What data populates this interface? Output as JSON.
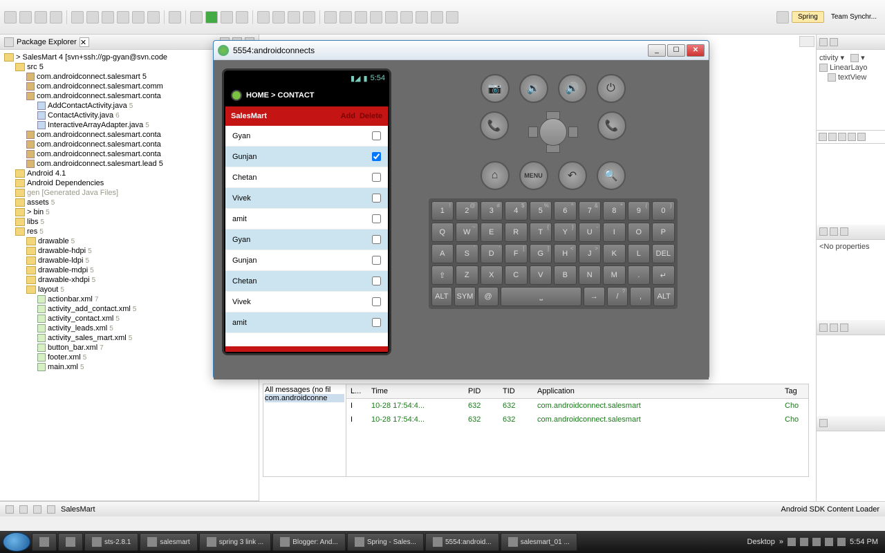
{
  "toolbar": {
    "perspectives": [
      "Spring",
      "Team Synchr..."
    ]
  },
  "packageExplorer": {
    "title": "Package Explorer",
    "root": "> SalesMart 4 [svn+ssh://gp-gyan@svn.code",
    "src": "src 5",
    "packages": [
      "com.androidconnect.salesmart 5",
      "com.androidconnect.salesmart.comm",
      "com.androidconnect.salesmart.conta"
    ],
    "javaFiles": [
      {
        "name": "AddContactActivity.java",
        "rev": "5"
      },
      {
        "name": "ContactActivity.java",
        "rev": "6"
      },
      {
        "name": "InteractiveArrayAdapter.java",
        "rev": "5"
      }
    ],
    "packages2": [
      "com.androidconnect.salesmart.conta",
      "com.androidconnect.salesmart.conta",
      "com.androidconnect.salesmart.conta",
      "com.androidconnect.salesmart.lead 5"
    ],
    "libs": [
      "Android 4.1",
      "Android Dependencies"
    ],
    "gen": "gen [Generated Java Files]",
    "folders": [
      {
        "name": "assets",
        "rev": "5"
      },
      {
        "name": "> bin",
        "rev": "5"
      },
      {
        "name": "libs",
        "rev": "5"
      },
      {
        "name": "res",
        "rev": "5"
      }
    ],
    "drawables": [
      {
        "name": "drawable",
        "rev": "5"
      },
      {
        "name": "drawable-hdpi",
        "rev": "5"
      },
      {
        "name": "drawable-ldpi",
        "rev": "5"
      },
      {
        "name": "drawable-mdpi",
        "rev": "5"
      },
      {
        "name": "drawable-xhdpi",
        "rev": "5"
      },
      {
        "name": "layout",
        "rev": "5"
      }
    ],
    "layouts": [
      {
        "name": "actionbar.xml",
        "rev": "7"
      },
      {
        "name": "activity_add_contact.xml",
        "rev": "5"
      },
      {
        "name": "activity_contact.xml",
        "rev": "5"
      },
      {
        "name": "activity_leads.xml",
        "rev": "5"
      },
      {
        "name": "activity_sales_mart.xml",
        "rev": "5"
      },
      {
        "name": "button_bar.xml",
        "rev": "7"
      },
      {
        "name": "footer.xml",
        "rev": "5"
      },
      {
        "name": "main.xml",
        "rev": "5"
      }
    ]
  },
  "rightPanel": {
    "perspDrop": "ctivity",
    "outline": [
      "LinearLayo",
      "textView"
    ],
    "noprops": "<No properties"
  },
  "emulator": {
    "title": "5554:androidconnects",
    "statusTime": "5:54",
    "breadcrumb": "HOME > CONTACT",
    "appTitle": "SalesMart",
    "actions": [
      "Add",
      "Delete"
    ],
    "contacts": [
      {
        "name": "Gyan",
        "checked": false,
        "alt": false
      },
      {
        "name": "Gunjan",
        "checked": true,
        "alt": true
      },
      {
        "name": "Chetan",
        "checked": false,
        "alt": false
      },
      {
        "name": "Vivek",
        "checked": false,
        "alt": true
      },
      {
        "name": "amit",
        "checked": false,
        "alt": false
      },
      {
        "name": "Gyan",
        "checked": false,
        "alt": true
      },
      {
        "name": "Gunjan",
        "checked": false,
        "alt": false
      },
      {
        "name": "Chetan",
        "checked": false,
        "alt": true
      },
      {
        "name": "Vivek",
        "checked": false,
        "alt": false
      },
      {
        "name": "amit",
        "checked": false,
        "alt": true
      }
    ],
    "kbdRows": [
      [
        {
          "m": "1",
          "s": "!"
        },
        {
          "m": "2",
          "s": "@"
        },
        {
          "m": "3",
          "s": "#"
        },
        {
          "m": "4",
          "s": "$"
        },
        {
          "m": "5",
          "s": "%"
        },
        {
          "m": "6",
          "s": "^"
        },
        {
          "m": "7",
          "s": "&"
        },
        {
          "m": "8",
          "s": "*"
        },
        {
          "m": "9",
          "s": "("
        },
        {
          "m": "0",
          "s": ")"
        }
      ],
      [
        {
          "m": "Q"
        },
        {
          "m": "W",
          "s": "~"
        },
        {
          "m": "E"
        },
        {
          "m": "R"
        },
        {
          "m": "T",
          "s": "{"
        },
        {
          "m": "Y",
          "s": "}"
        },
        {
          "m": "U",
          "s": "-"
        },
        {
          "m": "I"
        },
        {
          "m": "O"
        },
        {
          "m": "P"
        }
      ],
      [
        {
          "m": "A"
        },
        {
          "m": "S",
          "s": "`"
        },
        {
          "m": "D",
          "s": "'"
        },
        {
          "m": "F",
          "s": "["
        },
        {
          "m": "G",
          "s": "]"
        },
        {
          "m": "H",
          "s": "<"
        },
        {
          "m": "J",
          "s": ">"
        },
        {
          "m": "K",
          ";": ""
        },
        {
          "m": "L"
        },
        {
          "m": "DEL",
          "s": ""
        }
      ],
      [
        {
          "m": "⇧"
        },
        {
          "m": "Z"
        },
        {
          "m": "X"
        },
        {
          "m": "C"
        },
        {
          "m": "V"
        },
        {
          "m": "B"
        },
        {
          "m": "N"
        },
        {
          "m": "M"
        },
        {
          "m": "."
        },
        {
          "m": "↵"
        }
      ],
      [
        {
          "m": "ALT"
        },
        {
          "m": "SYM"
        },
        {
          "m": "@"
        },
        {
          "m": " "
        },
        {
          "m": "→"
        },
        {
          "m": "/",
          "s": "?"
        },
        {
          "m": ","
        },
        {
          "m": "ALT"
        }
      ]
    ],
    "hwBtns": {
      "menu": "MENU"
    }
  },
  "logcat": {
    "left": [
      "All messages (no fil",
      "com.androidconne"
    ],
    "headers": [
      "L...",
      "Time",
      "PID",
      "TID",
      "Application",
      "Tag"
    ],
    "rows": [
      {
        "l": "I",
        "t": "10-28 17:54:4...",
        "pid": "632",
        "tid": "632",
        "app": "com.androidconnect.salesmart",
        "tag": "Cho"
      },
      {
        "l": "I",
        "t": "10-28 17:54:4...",
        "pid": "632",
        "tid": "632",
        "app": "com.androidconnect.salesmart",
        "tag": "Cho"
      }
    ]
  },
  "statusBar": {
    "left": "SalesMart",
    "right": "Android SDK Content Loader"
  },
  "taskbar": {
    "items": [
      "sts-2.8.1",
      "salesmart",
      "spring 3 link ...",
      "Blogger: And...",
      "Spring - Sales...",
      "5554:android...",
      "salesmart_01 ..."
    ],
    "desktop": "Desktop",
    "time": "5:54 PM"
  }
}
